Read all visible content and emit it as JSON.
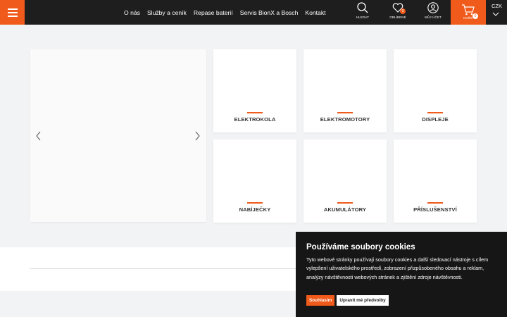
{
  "header": {
    "nav": [
      "O nás",
      "Služby a ceník",
      "Repase baterií",
      "Servis BionX a Bosch",
      "Kontakt"
    ],
    "search_label": "HLEDAT",
    "favorites_label": "OBLÍBENÉ",
    "favorites_count": "0",
    "account_label": "MŮJ ÚČET",
    "cart_label": "KOŠÍK",
    "cart_count": "0",
    "currency": "CZK",
    "accent": "#f05a1a"
  },
  "categories": [
    "ELEKTROKOLA",
    "ELEKTROMOTORY",
    "DISPLEJE",
    "NABÍJEČKY",
    "AKUMULÁTORY",
    "PŘÍSLUŠENSTVÍ"
  ],
  "cookie": {
    "title": "Používáme soubory cookies",
    "text": "Tyto webové stránky používají soubory cookies a další sledovací nástroje s cílem vylepšení uživatelského prostředí, zobrazení přizpůsobeného obsahu a reklam, analýzy návštěvnosti webových stránek a zjištění zdroje návštěvnosti.",
    "accept": "Souhlasím",
    "edit": "Upravit mé předvolby"
  }
}
